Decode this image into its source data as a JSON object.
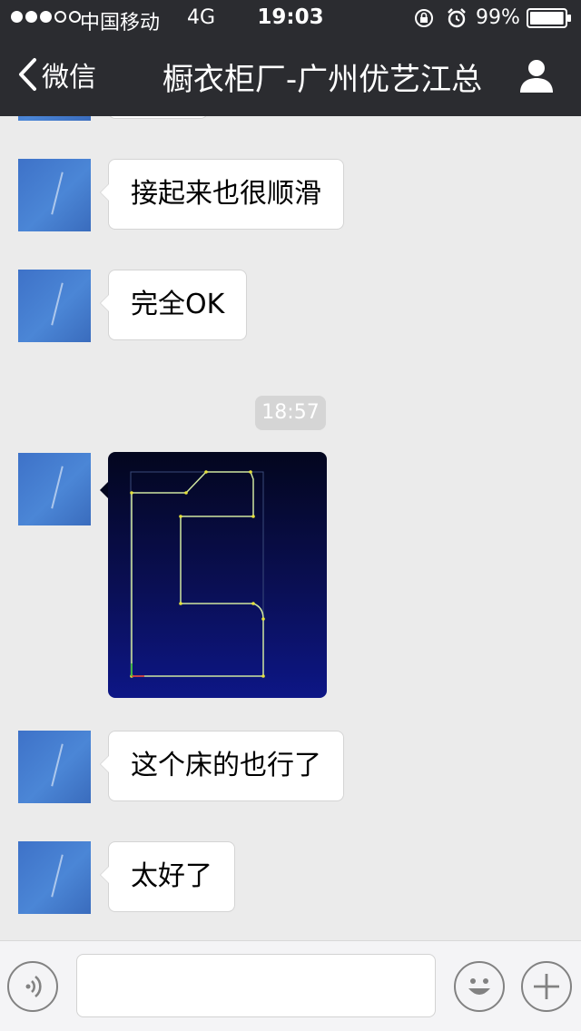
{
  "status_bar": {
    "carrier": "中国移动",
    "network": "4G",
    "time": "19:03",
    "battery_percent": "99%",
    "battery_level": 0.99,
    "signal_bars_filled": 3,
    "signal_bars_total": 5,
    "icons": [
      "rotation-lock-icon",
      "alarm-icon",
      "battery-icon"
    ]
  },
  "nav": {
    "back_label": "微信",
    "title": "橱衣柜厂-广州优艺江总",
    "profile_icon": "person-icon"
  },
  "messages": [
    {
      "type": "text",
      "text": "接起来也很顺滑"
    },
    {
      "type": "text",
      "text": "完全OK"
    },
    {
      "type": "time",
      "text": "18:57"
    },
    {
      "type": "image",
      "description_icon": "cad-drawing-image"
    },
    {
      "type": "text",
      "text": "这个床的也行了"
    },
    {
      "type": "text",
      "text": "太好了"
    }
  ],
  "input_bar": {
    "voice_icon": "voice-icon",
    "input_value": "",
    "emoji_icon": "emoji-icon",
    "plus_icon": "plus-icon"
  },
  "colors": {
    "nav_background": "#2b2c30",
    "chat_background": "#ebebeb",
    "bubble_background": "#ffffff",
    "time_stamp_background": "#d5d5d5"
  }
}
